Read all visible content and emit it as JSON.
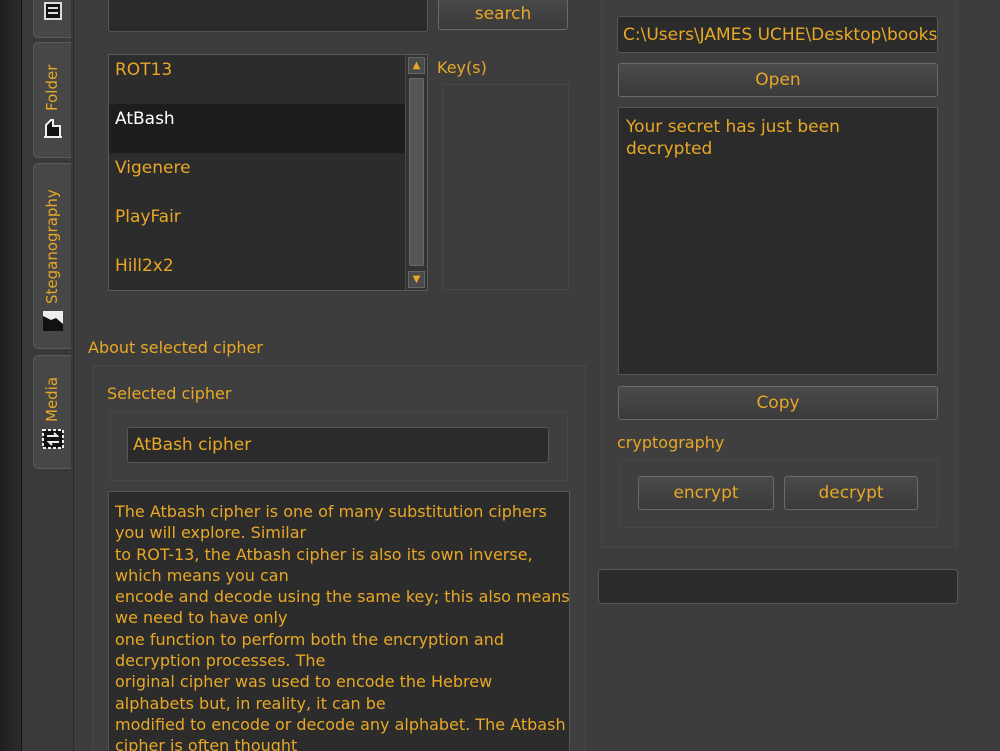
{
  "tabs": [
    {
      "label": "Folder",
      "icon": "folder-icon"
    },
    {
      "label": "Steganography",
      "icon": "image-icon"
    },
    {
      "label": "Media",
      "icon": "media-icon"
    }
  ],
  "search": {
    "button_label": "search",
    "value": ""
  },
  "cipher_list": {
    "items": [
      "ROT13",
      "AtBash",
      "Vigenere",
      "PlayFair",
      "Hill2x2"
    ],
    "selected": "AtBash"
  },
  "keys_label": "Key(s)",
  "about": {
    "section_label": "About selected cipher",
    "selected_label": "Selected cipher",
    "selected_value": "AtBash cipher",
    "description_lines": [
      "The Atbash cipher is one of many substitution ciphers",
      "you will explore. Similar",
      "to ROT-13, the Atbash cipher is also its own inverse,",
      "which means you can",
      "encode and decode using the same key; this also means",
      "we need to have only",
      "one function to perform both the encryption and",
      "decryption processes. The",
      "original cipher was used to encode the Hebrew",
      "alphabets but, in reality, it can be",
      "modified to encode or decode any alphabet. The Atbash",
      "cipher is often thought"
    ]
  },
  "file": {
    "path": "C:\\Users\\JAMES UCHE\\Desktop\\books\\f",
    "open_label": "Open"
  },
  "output": {
    "text": "Your secret has just been decrypted",
    "copy_label": "Copy"
  },
  "cryptography": {
    "label": "cryptography",
    "encrypt_label": "encrypt",
    "decrypt_label": "decrypt"
  },
  "status_bar": {
    "text": ""
  },
  "colors": {
    "accent": "#e8a826",
    "background": "#3d3d3d",
    "field": "#2b2b2b"
  }
}
